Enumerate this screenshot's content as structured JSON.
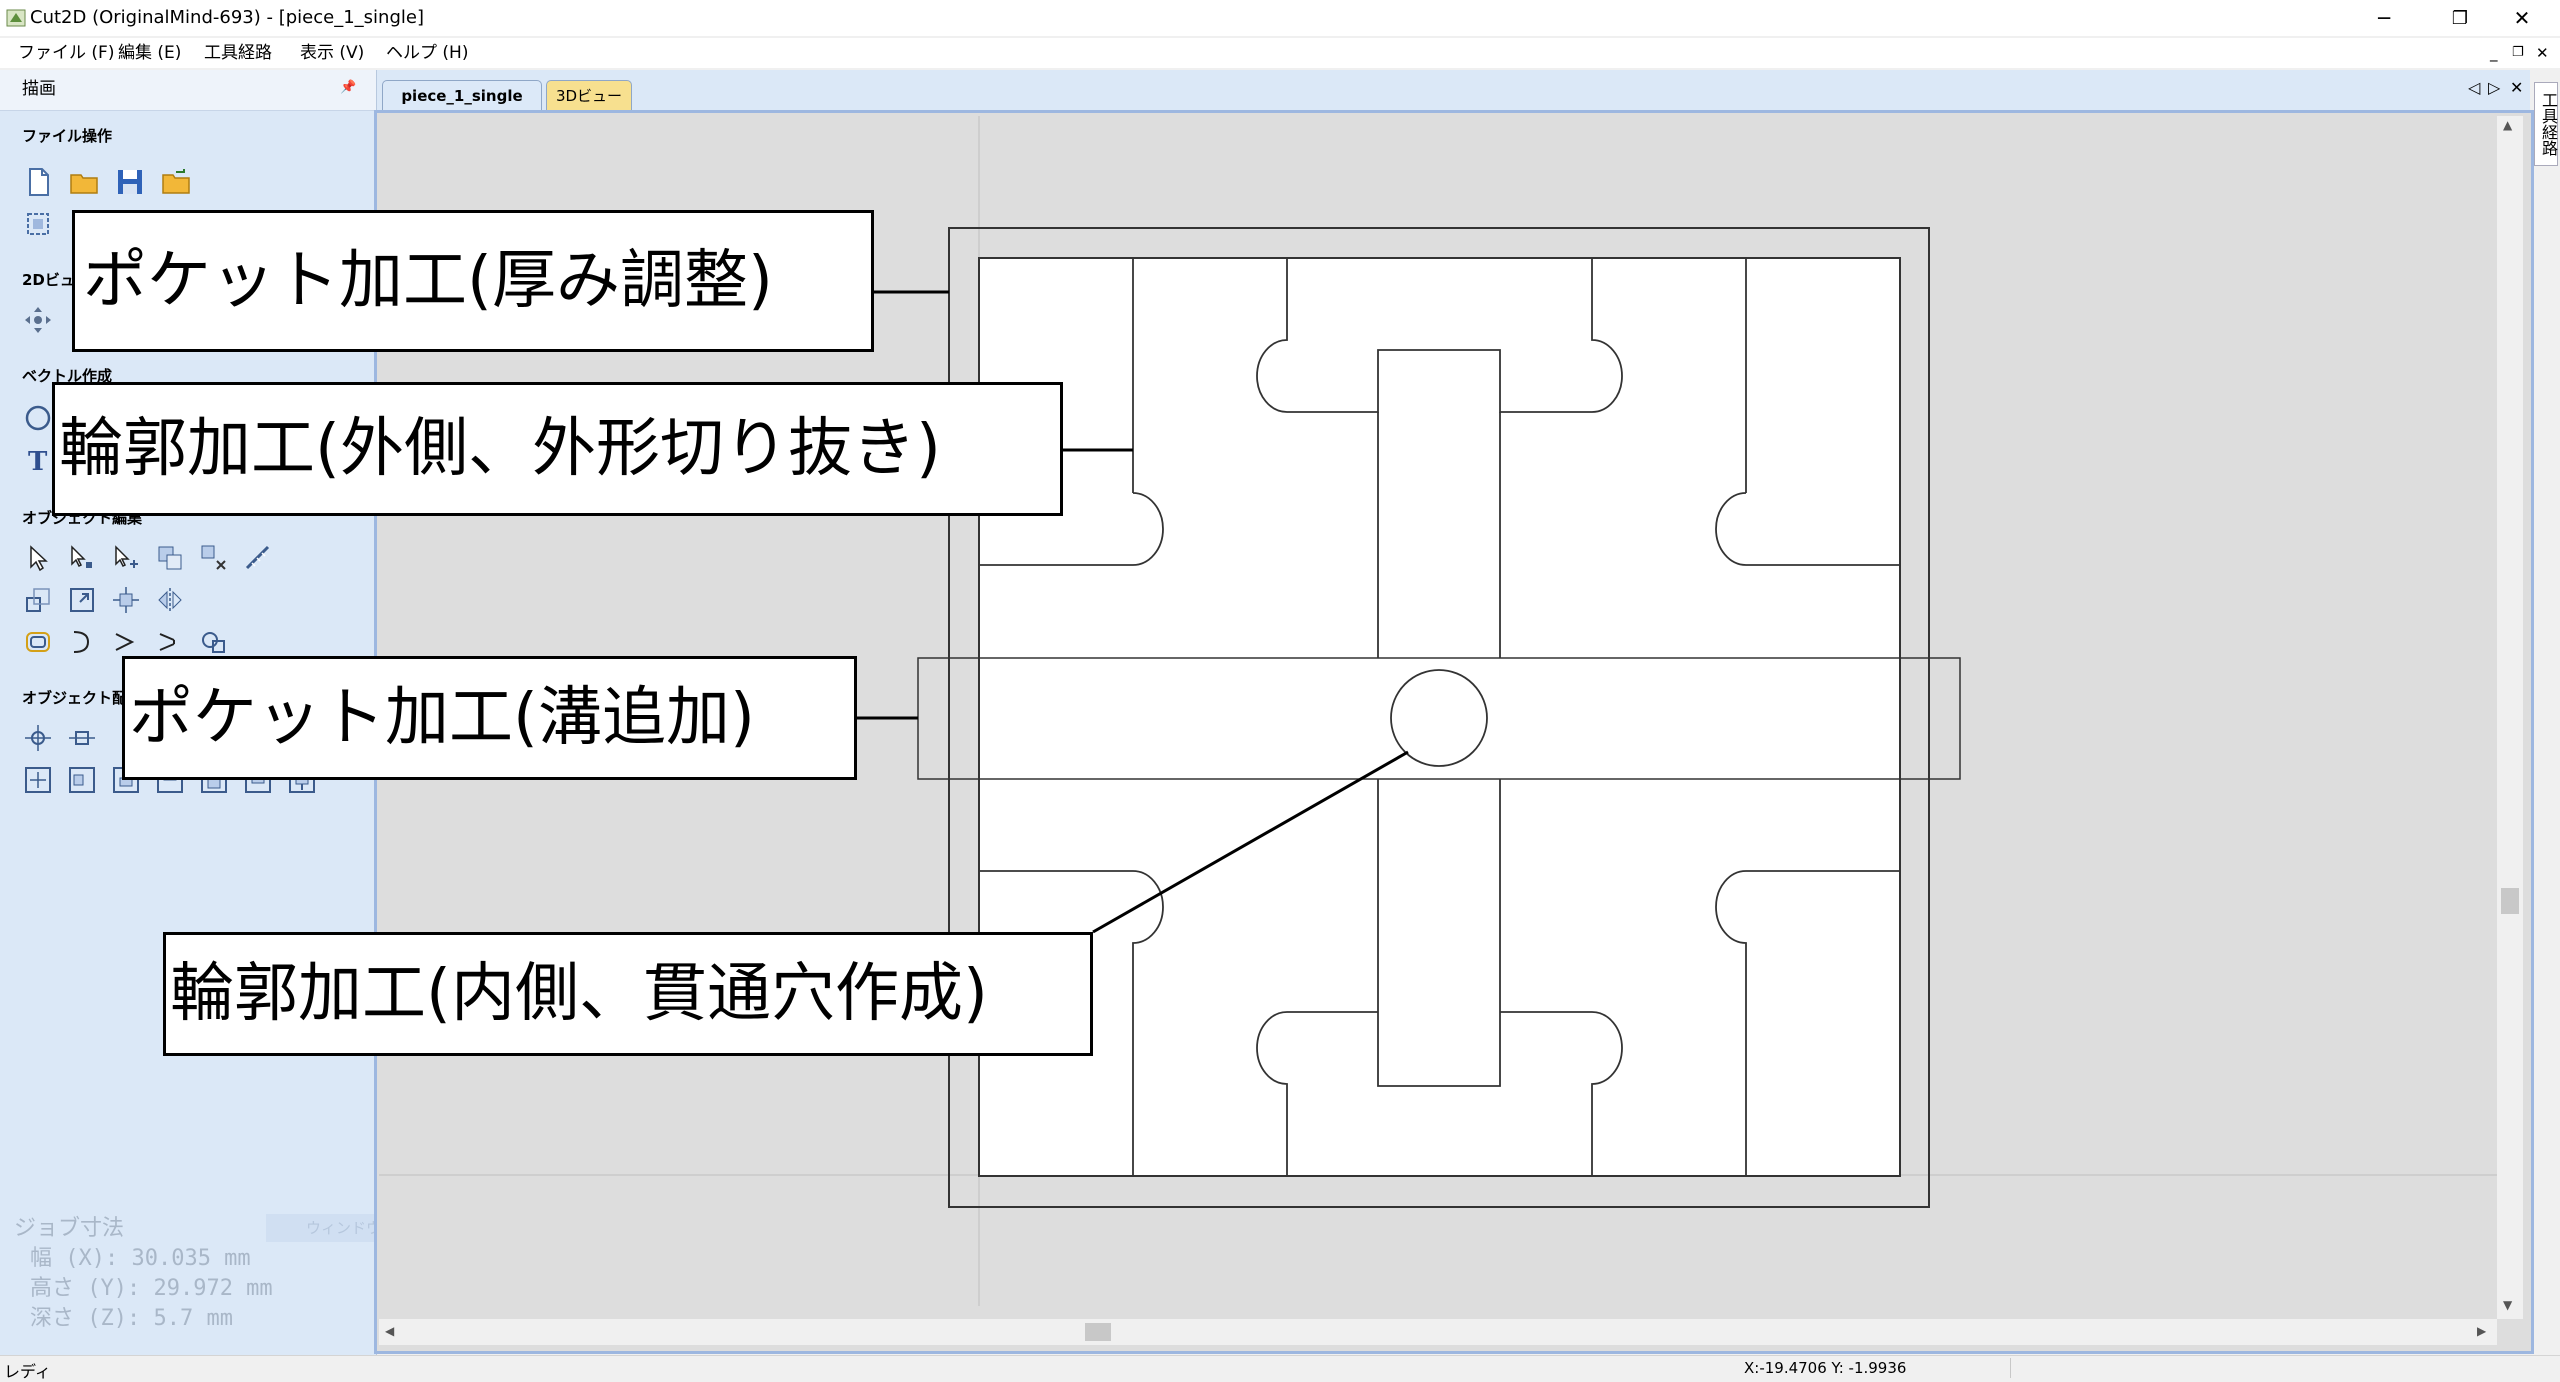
{
  "window": {
    "title": "Cut2D (OriginalMind-693) - [piece_1_single]",
    "minimize_glyph": "─",
    "restore_glyph": "❐",
    "close_glyph": "✕"
  },
  "menu": [
    {
      "label": "ファイル (F)"
    },
    {
      "label": "編集 (E)"
    },
    {
      "label": "工具経路"
    },
    {
      "label": "表示 (V)"
    },
    {
      "label": "ヘルプ (H)"
    }
  ],
  "mdi_controls": {
    "minimize": "_",
    "restore": "❐",
    "close": "✕"
  },
  "panel": {
    "title": "描画",
    "pin": "📌",
    "sections": {
      "file_ops": "ファイル操作",
      "view_2d": "2Dビュ",
      "vector_create": "ベクトル作成",
      "object_edit": "オブジェクト編集",
      "object_layout": "オブジェクト配"
    },
    "job_size": {
      "title": "ジョブ寸法",
      "width": "幅 (X): 30.035 mm",
      "height": "高さ (Y): 29.972 mm",
      "depth": "深さ (Z): 5.7 mm"
    },
    "ghost_button": "ウィンドウ横(縦)切り取り(W)"
  },
  "tabs": [
    {
      "label": "piece_1_single",
      "active": true
    },
    {
      "label": "3Dビュー",
      "active": false
    }
  ],
  "tab_nav": {
    "prev": "◁",
    "next": "▷",
    "close": "✕"
  },
  "right_strip_label": "工具経路",
  "annotations": [
    {
      "label": "ポケット加工(厚み調整)"
    },
    {
      "label": "輪郭加工(外側、外形切り抜き)"
    },
    {
      "label": "ポケット加工(溝追加)"
    },
    {
      "label": "輪郭加工(内側、貫通穴作成)"
    }
  ],
  "statusbar": {
    "left": "レディ",
    "coords": "X:-19.4706 Y: -1.9936"
  },
  "scroll": {
    "up": "▲",
    "down": "▼",
    "left": "◀",
    "right": "▶"
  },
  "colors": {
    "panel_bg": "#dbe8f7",
    "canvas_bg": "#dddddd",
    "active_tab": "#dce9f8",
    "inactive_tab": "#f7e08f",
    "frame": "#9db7e0"
  }
}
